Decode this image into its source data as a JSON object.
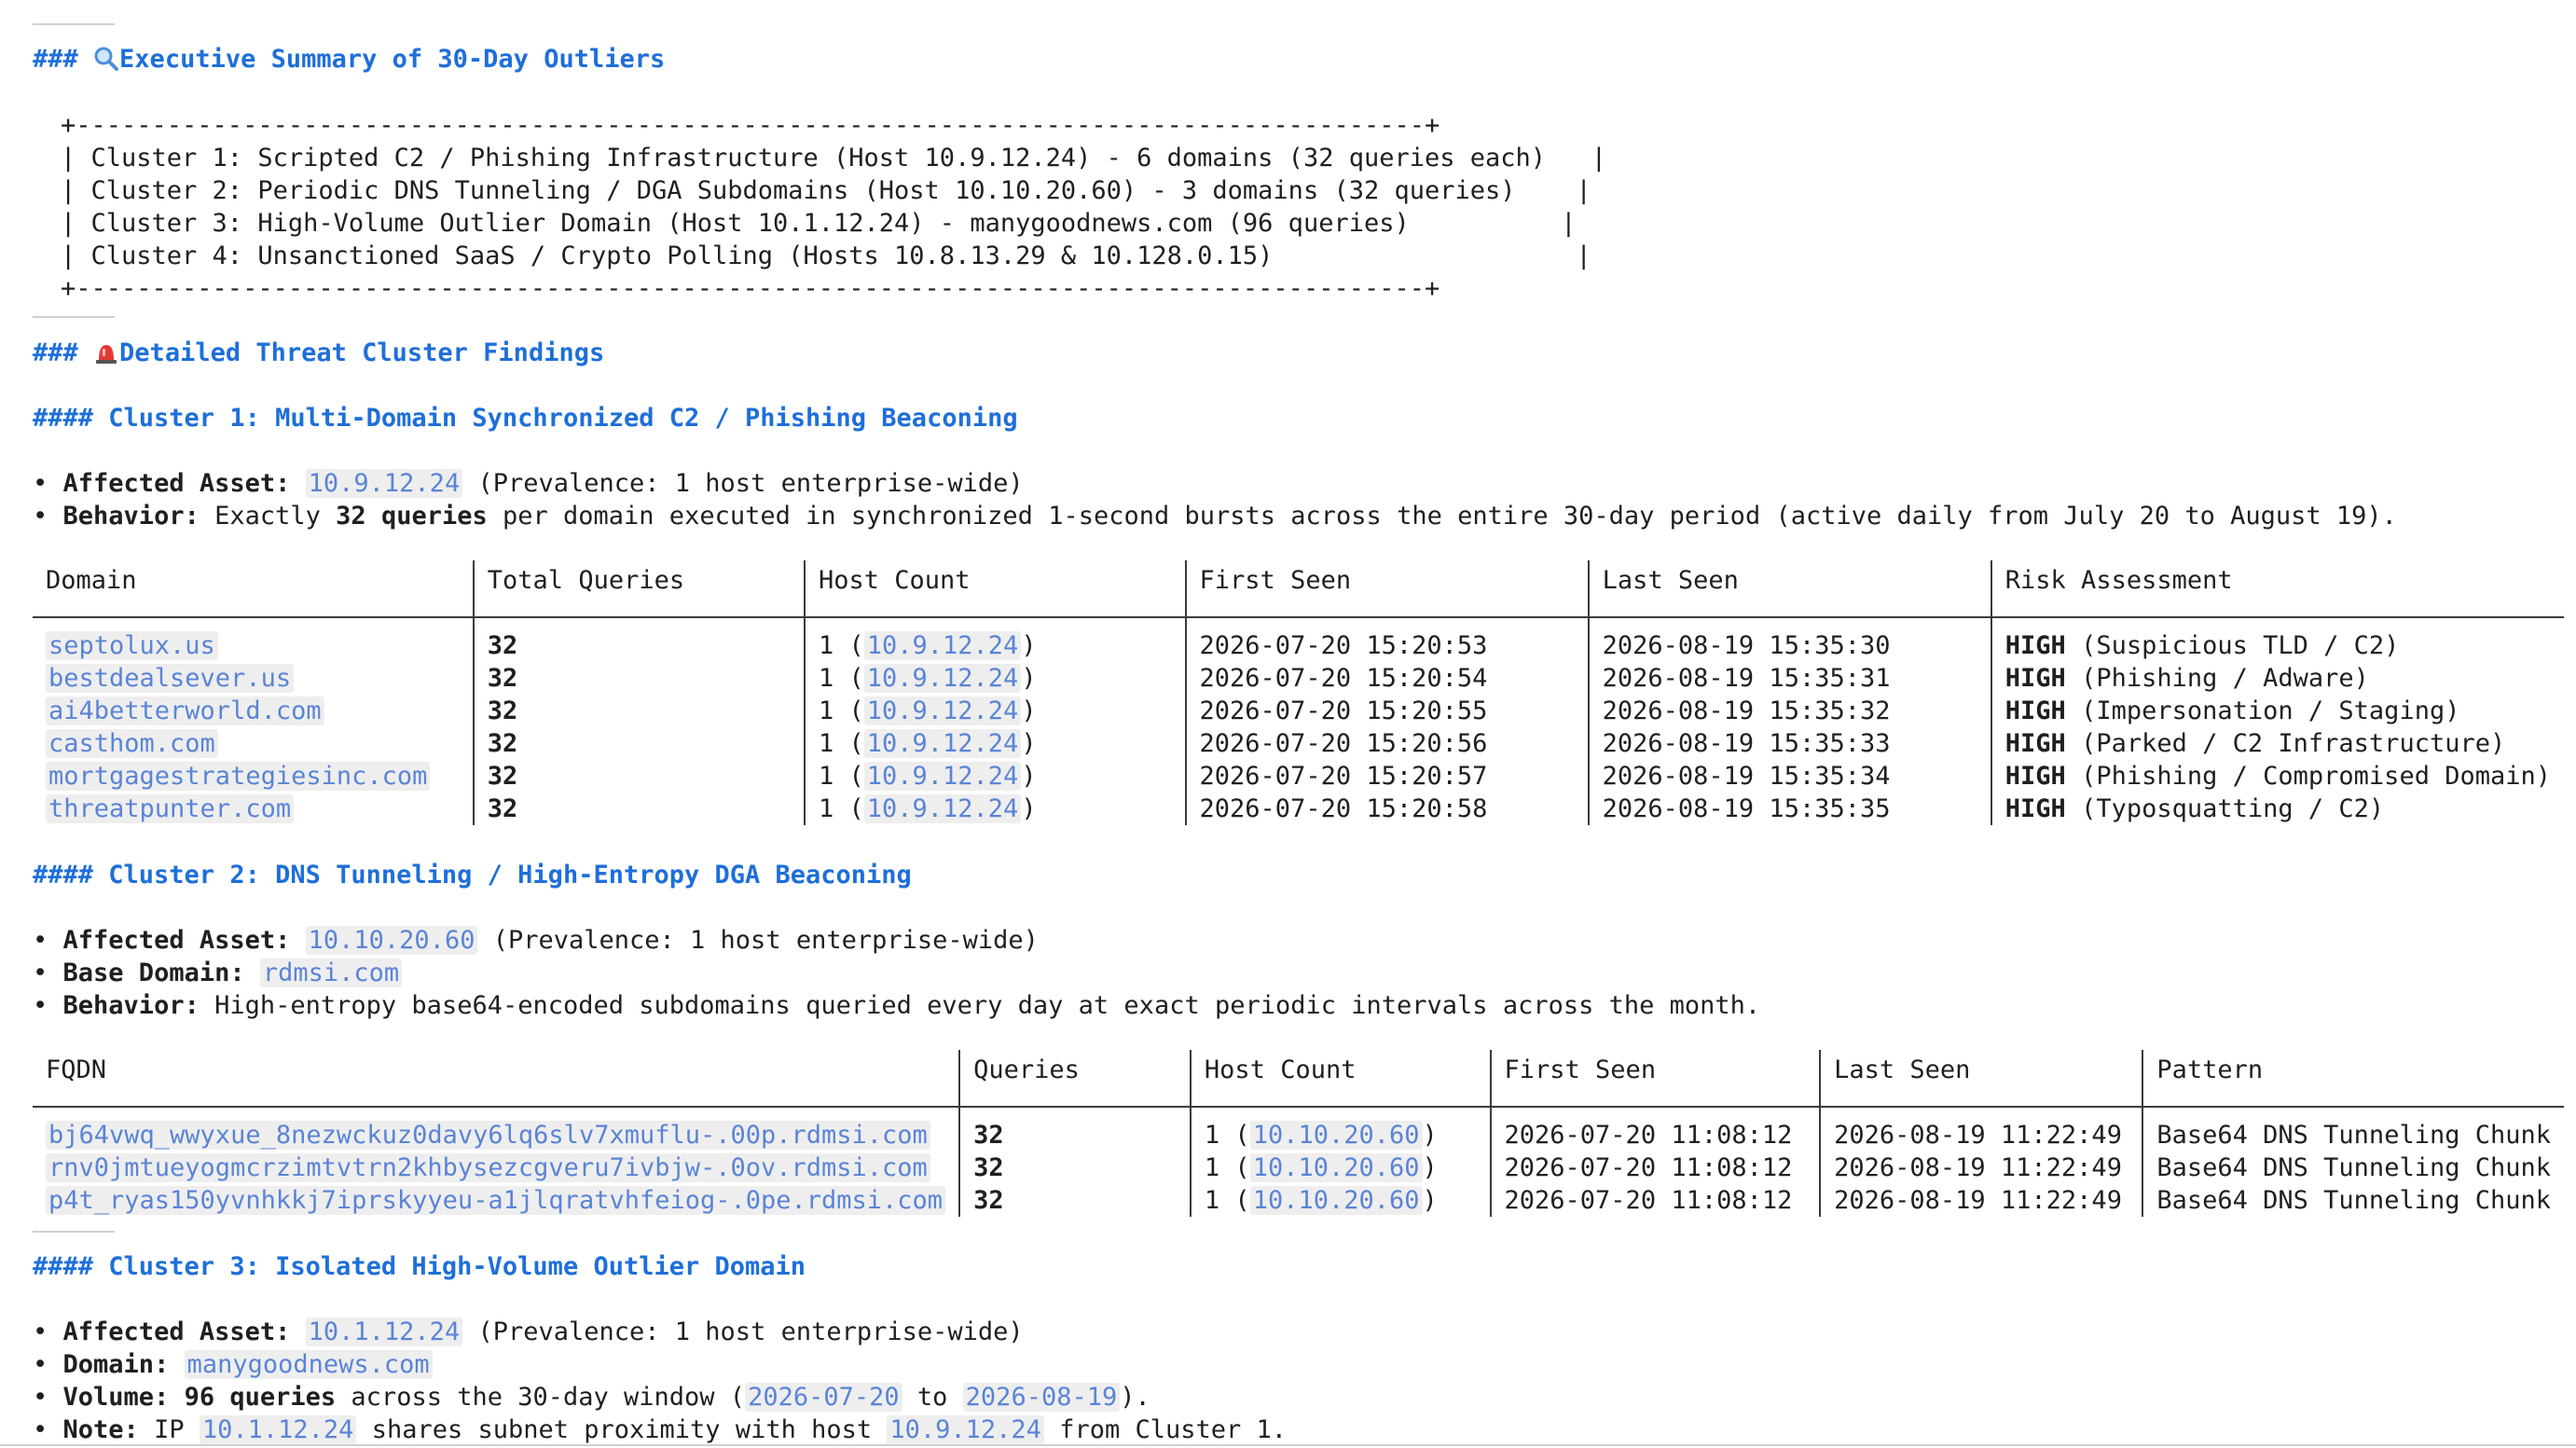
{
  "exec": {
    "heading_prefix": "###",
    "heading_icon": "magnifier-icon",
    "heading": "Executive Summary of 30-Day Outliers",
    "box_border": "+-----------------------------------------------------------------------------------------+",
    "box_lines": [
      "| Cluster 1: Scripted C2 / Phishing Infrastructure (Host 10.9.12.24) - 6 domains (32 queries each)   |",
      "| Cluster 2: Periodic DNS Tunneling / DGA Subdomains (Host 10.10.20.60) - 3 domains (32 queries)    |",
      "| Cluster 3: High-Volume Outlier Domain (Host 10.1.12.24) - manygoodnews.com (96 queries)          |",
      "| Cluster 4: Unsanctioned SaaS / Crypto Polling (Hosts 10.8.13.29 & 10.128.0.15)                    |"
    ]
  },
  "detail": {
    "heading_prefix": "###",
    "heading_icon": "siren-icon",
    "heading": "Detailed Threat Cluster Findings"
  },
  "c1": {
    "heading": "#### Cluster 1: Multi-Domain Synchronized C2 / Phishing Beaconing",
    "asset_label": "Affected Asset:",
    "asset": "10.9.12.24",
    "asset_note": "(Prevalence: 1 host enterprise-wide)",
    "behavior_label": "Behavior:",
    "behavior_pre": "Exactly",
    "behavior_bold": "32 queries",
    "behavior_post": "per domain executed in synchronized 1-second bursts across the entire 30-day period (active daily from July 20 to August 19).",
    "columns": [
      "Domain",
      "Total Queries",
      "Host Count",
      "First Seen",
      "Last Seen",
      "Risk Assessment"
    ],
    "rows": [
      {
        "domain": "septolux.us",
        "queries": "32",
        "hc_pre": "1 (",
        "hc_ip": "10.9.12.24",
        "hc_post": ")",
        "first": "2026-07-20 15:20:53",
        "last": "2026-08-19 15:35:30",
        "risk": "HIGH",
        "risk_note": "(Suspicious TLD / C2)"
      },
      {
        "domain": "bestdealsever.us",
        "queries": "32",
        "hc_pre": "1 (",
        "hc_ip": "10.9.12.24",
        "hc_post": ")",
        "first": "2026-07-20 15:20:54",
        "last": "2026-08-19 15:35:31",
        "risk": "HIGH",
        "risk_note": "(Phishing / Adware)"
      },
      {
        "domain": "ai4betterworld.com",
        "queries": "32",
        "hc_pre": "1 (",
        "hc_ip": "10.9.12.24",
        "hc_post": ")",
        "first": "2026-07-20 15:20:55",
        "last": "2026-08-19 15:35:32",
        "risk": "HIGH",
        "risk_note": "(Impersonation / Staging)"
      },
      {
        "domain": "casthom.com",
        "queries": "32",
        "hc_pre": "1 (",
        "hc_ip": "10.9.12.24",
        "hc_post": ")",
        "first": "2026-07-20 15:20:56",
        "last": "2026-08-19 15:35:33",
        "risk": "HIGH",
        "risk_note": "(Parked / C2 Infrastructure)"
      },
      {
        "domain": "mortgagestrategiesinc.com",
        "queries": "32",
        "hc_pre": "1 (",
        "hc_ip": "10.9.12.24",
        "hc_post": ")",
        "first": "2026-07-20 15:20:57",
        "last": "2026-08-19 15:35:34",
        "risk": "HIGH",
        "risk_note": "(Phishing / Compromised Domain)"
      },
      {
        "domain": "threatpunter.com",
        "queries": "32",
        "hc_pre": "1 (",
        "hc_ip": "10.9.12.24",
        "hc_post": ")",
        "first": "2026-07-20 15:20:58",
        "last": "2026-08-19 15:35:35",
        "risk": "HIGH",
        "risk_note": "(Typosquatting / C2)"
      }
    ]
  },
  "c2": {
    "heading": "#### Cluster 2: DNS Tunneling / High-Entropy DGA Beaconing",
    "asset_label": "Affected Asset:",
    "asset": "10.10.20.60",
    "asset_note": "(Prevalence: 1 host enterprise-wide)",
    "base_label": "Base Domain:",
    "base": "rdmsi.com",
    "behavior_label": "Behavior:",
    "behavior": "High-entropy base64-encoded subdomains queried every day at exact periodic intervals across the month.",
    "columns": [
      "FQDN",
      "Queries",
      "Host Count",
      "First Seen",
      "Last Seen",
      "Pattern"
    ],
    "rows": [
      {
        "fqdn": "bj64vwq_wwyxue_8nezwckuz0davy6lq6slv7xmuflu-.00p.rdmsi.com",
        "queries": "32",
        "hc_pre": "1 (",
        "hc_ip": "10.10.20.60",
        "hc_post": ")",
        "first": "2026-07-20 11:08:12",
        "last": "2026-08-19 11:22:49",
        "pattern": "Base64 DNS Tunneling Chunk"
      },
      {
        "fqdn": "rnv0jmtueyogmcrzimtvtrn2khbysezcgveru7ivbjw-.0ov.rdmsi.com",
        "queries": "32",
        "hc_pre": "1 (",
        "hc_ip": "10.10.20.60",
        "hc_post": ")",
        "first": "2026-07-20 11:08:12",
        "last": "2026-08-19 11:22:49",
        "pattern": "Base64 DNS Tunneling Chunk"
      },
      {
        "fqdn": "p4t_ryas150yvnhkkj7iprskyyeu-a1jlqratvhfeiog-.0pe.rdmsi.com",
        "queries": "32",
        "hc_pre": "1 (",
        "hc_ip": "10.10.20.60",
        "hc_post": ")",
        "first": "2026-07-20 11:08:12",
        "last": "2026-08-19 11:22:49",
        "pattern": "Base64 DNS Tunneling Chunk"
      }
    ]
  },
  "c3": {
    "heading": "#### Cluster 3: Isolated High-Volume Outlier Domain",
    "asset_label": "Affected Asset:",
    "asset": "10.1.12.24",
    "asset_note": "(Prevalence: 1 host enterprise-wide)",
    "domain_label": "Domain:",
    "domain": "manygoodnews.com",
    "volume_label": "Volume:",
    "volume_bold": "96 queries",
    "volume_mid": "across the 30-day window (",
    "volume_from": "2026-07-20",
    "volume_to_word": "to",
    "volume_to": "2026-08-19",
    "volume_end": ").",
    "note_label": "Note:",
    "note_pre": "IP",
    "note_ip1": "10.1.12.24",
    "note_mid": "shares subnet proximity with host",
    "note_ip2": "10.9.12.24",
    "note_post": "from Cluster 1."
  },
  "bullet": "•"
}
